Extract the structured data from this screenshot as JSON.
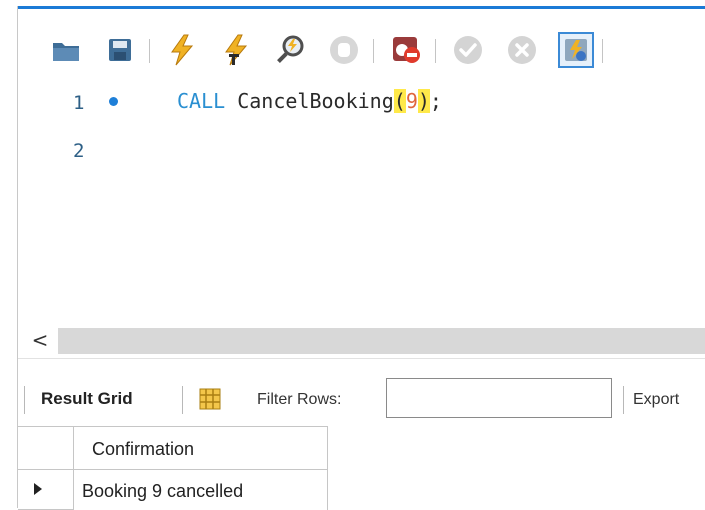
{
  "editor": {
    "lines": [
      {
        "number": "1",
        "keyword": "CALL",
        "procedure": "CancelBooking",
        "open_paren": "(",
        "argument": "9",
        "close_paren": ")",
        "terminator": ";"
      },
      {
        "number": "2"
      }
    ]
  },
  "toolbar": {
    "icons": [
      "open-folder-icon",
      "save-icon",
      "execute-icon",
      "execute-current-icon",
      "explain-icon",
      "stop-icon",
      "toggle-continue-on-error-icon",
      "commit-icon",
      "rollback-icon",
      "autocommit-icon"
    ]
  },
  "scrollbar": {
    "left_arrow": "<"
  },
  "result_toolbar": {
    "result_grid_label": "Result Grid",
    "filter_rows_label": "Filter Rows:",
    "filter_value": "",
    "export_label": "Export"
  },
  "result_grid": {
    "columns": [
      "Confirmation"
    ],
    "rows": [
      [
        "Booking 9 cancelled"
      ]
    ]
  },
  "colors": {
    "accent": "#1b7ad6",
    "keyword": "#2a8fd1",
    "number": "#e0663d",
    "bracket_highlight": "#ffe94a"
  }
}
